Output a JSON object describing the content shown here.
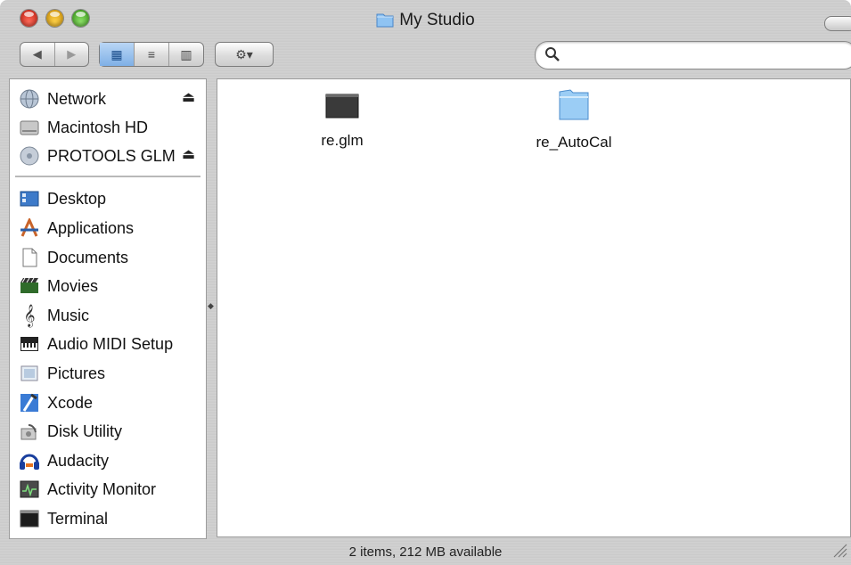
{
  "window": {
    "title": "My Studio",
    "status_text": "2 items, 212 MB available"
  },
  "toolbar": {
    "back_label": "◀",
    "forward_label": "▶",
    "view_icon": "▦",
    "view_list": "≡",
    "view_columns": "▥",
    "action_label": "⚙▾",
    "search_placeholder": ""
  },
  "sidebar": {
    "devices": [
      {
        "label": "Network",
        "icon": "network-icon",
        "eject": true
      },
      {
        "label": "Macintosh HD",
        "icon": "hard-drive-icon",
        "eject": false
      },
      {
        "label": "PROTOOLS GLM",
        "icon": "disk-icon",
        "eject": true
      }
    ],
    "places": [
      {
        "label": "Desktop",
        "icon": "desktop-icon"
      },
      {
        "label": "Applications",
        "icon": "applications-icon"
      },
      {
        "label": "Documents",
        "icon": "documents-icon"
      },
      {
        "label": "Movies",
        "icon": "movies-icon"
      },
      {
        "label": "Music",
        "icon": "music-icon"
      },
      {
        "label": "Audio MIDI Setup",
        "icon": "piano-icon"
      },
      {
        "label": "Pictures",
        "icon": "pictures-icon"
      },
      {
        "label": "Xcode",
        "icon": "xcode-icon"
      },
      {
        "label": "Disk Utility",
        "icon": "disk-utility-icon"
      },
      {
        "label": "Audacity",
        "icon": "audacity-icon"
      },
      {
        "label": "Activity Monitor",
        "icon": "activity-monitor-icon"
      },
      {
        "label": "Terminal",
        "icon": "terminal-icon"
      }
    ]
  },
  "files": [
    {
      "name": "re.glm",
      "icon": "document-icon"
    },
    {
      "name": "re_AutoCal",
      "icon": "folder-icon"
    }
  ],
  "colors": {
    "selection_blue": "#7fb0e6",
    "window_gray": "#cfcfcf"
  }
}
